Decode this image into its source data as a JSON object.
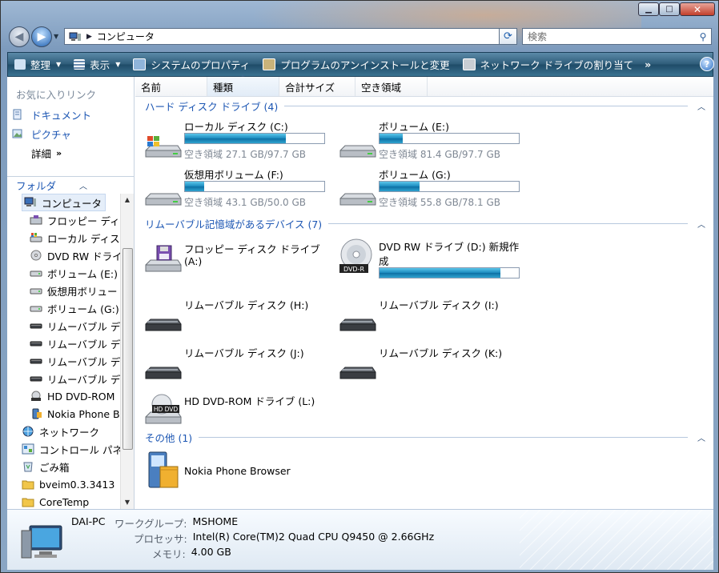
{
  "window": {
    "controls": {
      "minimize": "▁",
      "maximize": "□",
      "close": "✕"
    }
  },
  "nav": {
    "back_glyph": "◀",
    "forward_glyph": "▶",
    "address": "コンピュータ",
    "search_placeholder": "検索"
  },
  "toolbar": {
    "items": [
      {
        "label": "整理",
        "has_caret": true
      },
      {
        "label": "表示",
        "has_caret": true
      },
      {
        "label": "システムのプロパティ"
      },
      {
        "label": "プログラムのアンインストールと変更"
      },
      {
        "label": "ネットワーク ドライブの割り当て"
      }
    ],
    "more": "»",
    "help": "?"
  },
  "sidebar": {
    "favorites_title": "お気に入りリンク",
    "favorites": [
      "ドキュメント",
      "ピクチャ"
    ],
    "more_label": "詳細",
    "more_chevron": "»",
    "folders_title": "フォルダ",
    "tree": [
      {
        "label": "コンピュータ",
        "indent": 1,
        "icon": "computer-icon",
        "selected": true
      },
      {
        "label": "フロッピー ディ",
        "indent": 2,
        "icon": "floppy-icon"
      },
      {
        "label": "ローカル ディス",
        "indent": 2,
        "icon": "windows-drive-icon"
      },
      {
        "label": "DVD RW ドライ",
        "indent": 2,
        "icon": "dvd-icon"
      },
      {
        "label": "ボリューム (E:)",
        "indent": 2,
        "icon": "drive-icon"
      },
      {
        "label": "仮想用ボリュー",
        "indent": 2,
        "icon": "drive-icon"
      },
      {
        "label": "ボリューム (G:)",
        "indent": 2,
        "icon": "drive-icon"
      },
      {
        "label": "リムーバブル デ",
        "indent": 2,
        "icon": "removable-icon"
      },
      {
        "label": "リムーバブル デ",
        "indent": 2,
        "icon": "removable-icon"
      },
      {
        "label": "リムーバブル デ",
        "indent": 2,
        "icon": "removable-icon"
      },
      {
        "label": "リムーバブル デ",
        "indent": 2,
        "icon": "removable-icon"
      },
      {
        "label": "HD DVD-ROM",
        "indent": 2,
        "icon": "hddvd-icon"
      },
      {
        "label": "Nokia Phone Br",
        "indent": 2,
        "icon": "nokia-icon"
      },
      {
        "label": "ネットワーク",
        "indent": 1,
        "icon": "network-icon"
      },
      {
        "label": "コントロール パネ",
        "indent": 1,
        "icon": "control-panel-icon"
      },
      {
        "label": "ごみ箱",
        "indent": 1,
        "icon": "recycle-bin-icon"
      },
      {
        "label": "bveim0.3.3413",
        "indent": 1,
        "icon": "folder-icon"
      },
      {
        "label": "CoreTemp",
        "indent": 1,
        "icon": "folder-icon"
      }
    ]
  },
  "columns": [
    "名前",
    "種類",
    "合計サイズ",
    "空き領域"
  ],
  "sort_indicator": "ˆ",
  "groups": {
    "hdd": {
      "title": "ハード ディスク ドライブ (4)"
    },
    "removable": {
      "title": "リムーバブル記憶域があるデバイス (7)"
    },
    "other": {
      "title": "その他 (1)"
    }
  },
  "hdd_items": [
    {
      "name": "ローカル ディスク (C:)",
      "free": "空き領域 27.1 GB/97.7 GB",
      "used_fraction": 0.723,
      "icon": "windows-drive-icon"
    },
    {
      "name": "ボリューム (E:)",
      "free": "空き領域 81.4 GB/97.7 GB",
      "used_fraction": 0.167,
      "icon": "drive-icon"
    },
    {
      "name": "仮想用ボリューム (F:)",
      "free": "空き領域 43.1 GB/50.0 GB",
      "used_fraction": 0.138,
      "icon": "drive-icon"
    },
    {
      "name": "ボリューム (G:)",
      "free": "空き領域 55.8 GB/78.1 GB",
      "used_fraction": 0.286,
      "icon": "drive-icon"
    }
  ],
  "removable_items": [
    {
      "name": "フロッピー ディスク ドライブ",
      "name2": "(A:)",
      "icon": "floppy-drive-icon"
    },
    {
      "name": "DVD RW ドライブ (D:) 新規作",
      "name2": "成",
      "used_fraction": 0.87,
      "icon": "dvd-rw-icon",
      "icon_label": "DVD-R"
    },
    {
      "name": "リムーバブル ディスク (H:)",
      "icon": "removable-disk-icon"
    },
    {
      "name": "リムーバブル ディスク (I:)",
      "icon": "removable-disk-icon"
    },
    {
      "name": "リムーバブル ディスク (J:)",
      "icon": "removable-disk-icon"
    },
    {
      "name": "リムーバブル ディスク (K:)",
      "icon": "removable-disk-icon"
    },
    {
      "name": "HD DVD-ROM ドライブ (L:)",
      "icon": "hd-dvd-drive-icon",
      "icon_label": "HD DVD"
    }
  ],
  "other_items": [
    {
      "name": "Nokia Phone Browser",
      "icon": "nokia-phone-browser-icon"
    }
  ],
  "status": {
    "pc_name": "DAI-PC",
    "workgroup_label": "ワークグループ:",
    "workgroup": "MSHOME",
    "cpu_label": "プロセッサ:",
    "cpu": "Intel(R) Core(TM)2 Quad  CPU   Q9450  @ 2.66GHz",
    "mem_label": "メモリ:",
    "mem": "4.00 GB"
  },
  "colors": {
    "link": "#1c56b3",
    "bar_fill": "#1989bd",
    "toolbar": "#2d5b78"
  }
}
